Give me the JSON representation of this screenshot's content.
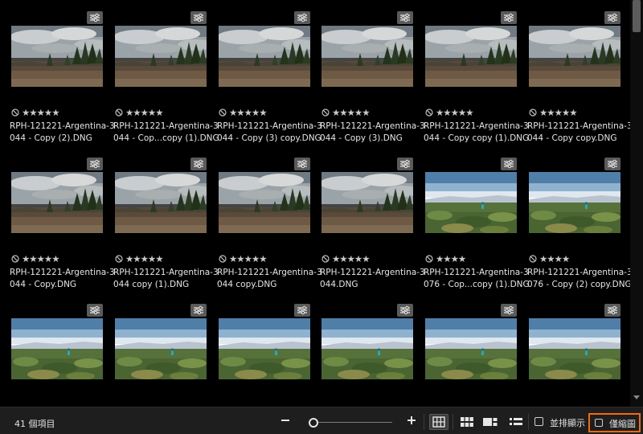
{
  "colors": {
    "background": "#000000",
    "statusbar": "#1e1e1e",
    "highlight_border": "#f26a10",
    "text": "#e6e6e6"
  },
  "grid": {
    "items": [
      {
        "name_line1": "RPH-121221-Argentina-3",
        "name_line2": "044 - Copy (2).DNG",
        "stars": "★★★★★",
        "scene": "dry",
        "edited": true
      },
      {
        "name_line1": "RPH-121221-Argentina-3",
        "name_line2": "044 - Cop...copy (1).DNG",
        "stars": "★★★★★",
        "scene": "dry",
        "edited": true
      },
      {
        "name_line1": "RPH-121221-Argentina-3",
        "name_line2": "044 - Copy (3) copy.DNG",
        "stars": "★★★★★",
        "scene": "dry",
        "edited": true
      },
      {
        "name_line1": "RPH-121221-Argentina-3",
        "name_line2": "044 - Copy (3).DNG",
        "stars": "★★★★★",
        "scene": "dry",
        "edited": true
      },
      {
        "name_line1": "RPH-121221-Argentina-3",
        "name_line2": "044 - Copy copy (1).DNG",
        "stars": "★★★★★",
        "scene": "dry",
        "edited": true
      },
      {
        "name_line1": "RPH-121221-Argentina-3",
        "name_line2": "044 - Copy copy.DNG",
        "stars": "★★★★★",
        "scene": "dry",
        "edited": true
      },
      {
        "name_line1": "RPH-121221-Argentina-3",
        "name_line2": "044 - Copy.DNG",
        "stars": "★★★★★",
        "scene": "dry",
        "edited": true
      },
      {
        "name_line1": "RPH-121221-Argentina-3",
        "name_line2": "044 copy (1).DNG",
        "stars": "★★★★★",
        "scene": "dry",
        "edited": true
      },
      {
        "name_line1": "RPH-121221-Argentina-3",
        "name_line2": "044 copy.DNG",
        "stars": "★★★★★",
        "scene": "dry",
        "edited": true
      },
      {
        "name_line1": "RPH-121221-Argentina-3",
        "name_line2": "044.DNG",
        "stars": "★★★★★",
        "scene": "dry",
        "edited": true
      },
      {
        "name_line1": "RPH-121221-Argentina-3",
        "name_line2": "076 - Cop...copy (1).DNG",
        "stars": "★★★★",
        "scene": "green",
        "edited": true
      },
      {
        "name_line1": "RPH-121221-Argentina-3",
        "name_line2": "076 - Copy (2) copy.DNG",
        "stars": "★★★★",
        "scene": "green",
        "edited": true
      },
      {
        "name_line1": "",
        "name_line2": "",
        "stars": "",
        "scene": "green",
        "edited": true
      },
      {
        "name_line1": "",
        "name_line2": "",
        "stars": "",
        "scene": "green",
        "edited": true
      },
      {
        "name_line1": "",
        "name_line2": "",
        "stars": "",
        "scene": "green",
        "edited": true
      },
      {
        "name_line1": "",
        "name_line2": "",
        "stars": "",
        "scene": "green",
        "edited": true
      },
      {
        "name_line1": "",
        "name_line2": "",
        "stars": "",
        "scene": "green",
        "edited": true
      },
      {
        "name_line1": "",
        "name_line2": "",
        "stars": "",
        "scene": "green",
        "edited": true
      }
    ]
  },
  "statusbar": {
    "item_count": "41 個項目",
    "zoom_level": 0.05,
    "side_by_side_label": "並排顯示",
    "side_by_side_checked": false,
    "thumbnails_only_label": "僅縮圖",
    "thumbnails_only_checked": false,
    "active_view": "grid",
    "icons": [
      "zoom-out-icon",
      "zoom-in-icon",
      "grid-view-icon",
      "large-grid-view-icon",
      "compare-view-icon",
      "list-view-icon"
    ]
  }
}
